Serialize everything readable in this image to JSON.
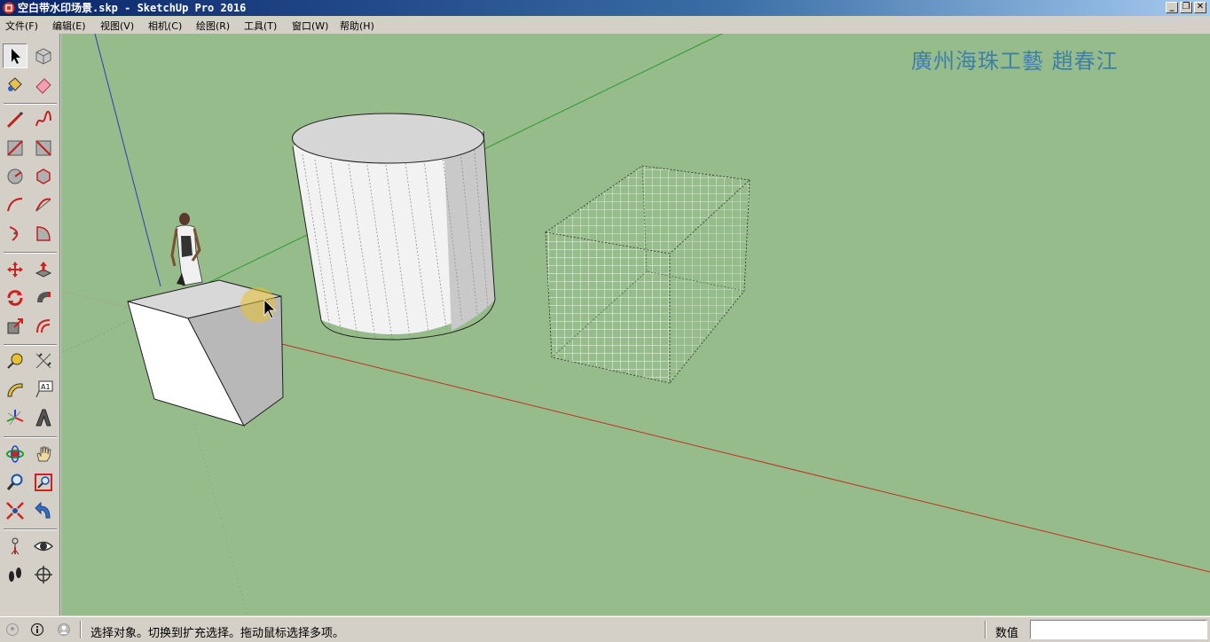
{
  "window": {
    "title": "空白带水印场景.skp - SketchUp Pro 2016",
    "minimize": "_",
    "restore": "❐",
    "close": "✕"
  },
  "menu": [
    {
      "label": "文件(F)"
    },
    {
      "label": "编辑(E)"
    },
    {
      "label": "视图(V)"
    },
    {
      "label": "相机(C)"
    },
    {
      "label": "绘图(R)"
    },
    {
      "label": "工具(T)"
    },
    {
      "label": "窗口(W)"
    },
    {
      "label": "帮助(H)"
    }
  ],
  "toolbar": {
    "text_tool_glyph": "A1",
    "icons": [
      "select-arrow-icon",
      "make-component-icon",
      "paint-bucket-icon",
      "eraser-icon",
      "pencil-line-icon",
      "freehand-icon",
      "rectangle-icon",
      "rotated-rectangle-icon",
      "circle-icon",
      "polygon-icon",
      "arc-icon",
      "two-point-arc-icon",
      "three-point-arc-icon",
      "pie-icon",
      "move-icon",
      "push-pull-icon",
      "rotate-icon",
      "follow-me-icon",
      "scale-icon",
      "offset-icon",
      "tape-measure-icon",
      "dimension-icon",
      "protractor-icon",
      "text-icon",
      "axes-icon",
      "3d-text-icon",
      "orbit-icon",
      "pan-icon",
      "zoom-icon",
      "zoom-window-icon",
      "zoom-extents-icon",
      "previous-view-icon",
      "position-camera-icon",
      "look-around-icon",
      "walk-icon",
      "section-plane-icon"
    ]
  },
  "viewport": {
    "watermark": "廣州海珠工藝 趙春江",
    "background": "#97bc8b",
    "watermark_color": "#3d7fa6"
  },
  "statusbar": {
    "hint": "选择对象。切换到扩充选择。拖动鼠标选择多项。",
    "measurements_label": "数值",
    "measurements_value": ""
  }
}
